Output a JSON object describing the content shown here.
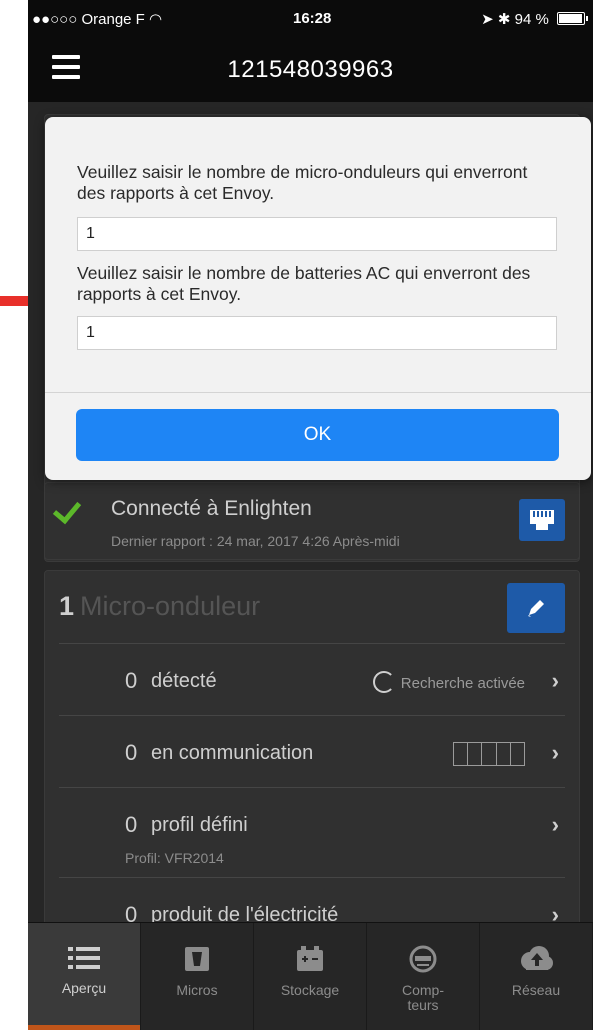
{
  "status_bar": {
    "carrier": "●●○○○ Orange F",
    "time": "16:28",
    "battery": "94 %"
  },
  "nav": {
    "title": "121548039963"
  },
  "modal": {
    "label_micro": "Veuillez saisir le nombre de micro-onduleurs qui enverront des rapports à cet Envoy.",
    "value_micro": "1",
    "label_batteries": "Veuillez saisir le nombre de batteries AC qui enverront des rapports à cet Envoy.",
    "value_batteries": "1",
    "ok_label": "OK"
  },
  "connection": {
    "title": "Connecté à Enlighten",
    "last_report": "Dernier rapport : 24 mar, 2017 4:26 Après-midi"
  },
  "micro": {
    "count": "1",
    "title": "Micro-onduleur",
    "rows": [
      {
        "count": "0",
        "label": "détecté",
        "aside": "Recherche activée"
      },
      {
        "count": "0",
        "label": "en communication"
      },
      {
        "count": "0",
        "label": "profil défini",
        "sub": "Profil: VFR2014"
      },
      {
        "count": "0",
        "label": "produit de l'électricité"
      }
    ]
  },
  "tabs": [
    {
      "label": "Aperçu",
      "icon": "list-icon",
      "active": true
    },
    {
      "label": "Micros",
      "icon": "microinverter-icon"
    },
    {
      "label": "Stockage",
      "icon": "battery-storage-icon"
    },
    {
      "label": "Comp-\nteurs",
      "icon": "meter-icon"
    },
    {
      "label": "Réseau",
      "icon": "cloud-upload-icon"
    }
  ],
  "colors": {
    "accent_blue": "#1e85f5",
    "check_green": "#5cb82a",
    "active_tab_bar": "#c0551a",
    "annotation_arrow": "#e8302a"
  }
}
